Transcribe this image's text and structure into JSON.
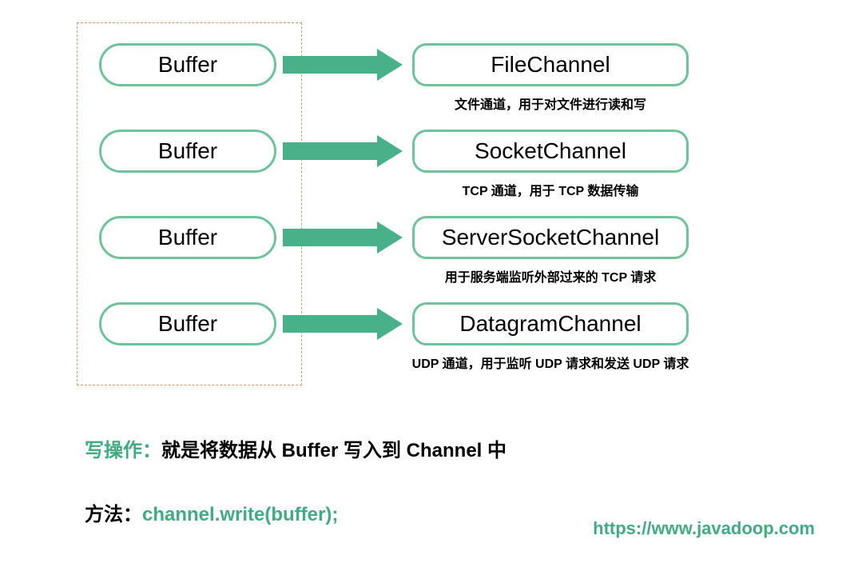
{
  "rows": [
    {
      "buffer_label": "Buffer",
      "channel_label": "FileChannel",
      "desc": "文件通道，用于对文件进行读和写"
    },
    {
      "buffer_label": "Buffer",
      "channel_label": "SocketChannel",
      "desc": "TCP 通道，用于 TCP 数据传输"
    },
    {
      "buffer_label": "Buffer",
      "channel_label": "ServerSocketChannel",
      "desc": "用于服务端监听外部过来的 TCP 请求"
    },
    {
      "buffer_label": "Buffer",
      "channel_label": "DatagramChannel",
      "desc": "UDP 通道，用于监听 UDP 请求和发送 UDP 请求"
    }
  ],
  "explain": {
    "write_label": "写操作：",
    "write_text": "就是将数据从 Buffer 写入到 Channel 中",
    "method_label": "方法：",
    "method_text": "channel.write(buffer);"
  },
  "footer_url": "https://www.javadoop.com"
}
